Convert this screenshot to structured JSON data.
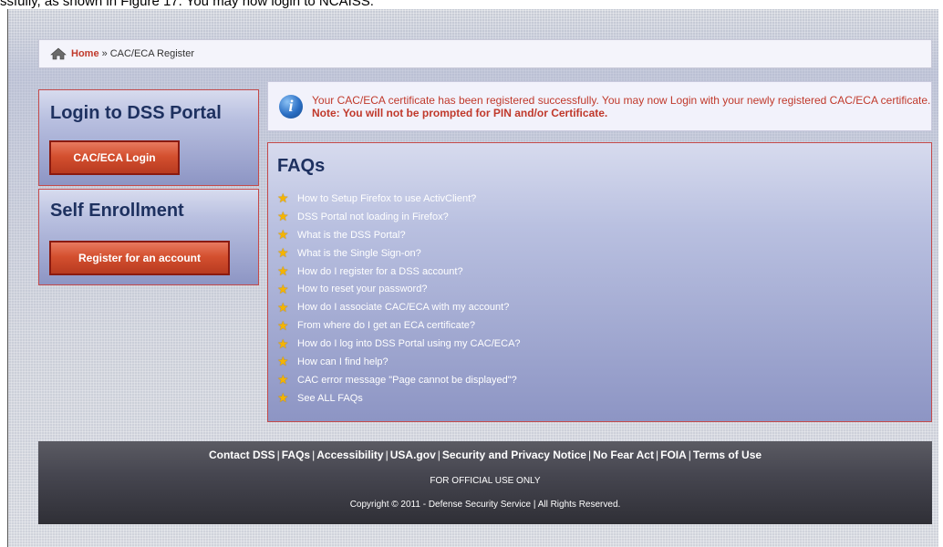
{
  "doc_caption": "ssfully, as shown in Figure 17. You may now login to NCAISS.",
  "breadcrumb": {
    "home": "Home",
    "separator": "»",
    "current": "CAC/ECA Register"
  },
  "login_panel": {
    "title": "Login to DSS Portal",
    "button": "CAC/ECA Login"
  },
  "enroll_panel": {
    "title": "Self Enrollment",
    "button": "Register for an account"
  },
  "alert": {
    "icon": "info-icon",
    "message": "Your CAC/ECA certificate has been registered successfully. You may now Login with your newly registered CAC/ECA certificate.",
    "note": "Note: You will not be prompted for PIN and/or Certificate."
  },
  "faqs": {
    "title": "FAQs",
    "items": [
      "How to Setup Firefox to use ActivClient?",
      "DSS Portal not loading in Firefox?",
      "What is the DSS Portal?",
      "What is the Single Sign-on?",
      "How do I register for a DSS account?",
      "How to reset your password?",
      "How do I associate CAC/ECA with my account?",
      "From where do I get an ECA certificate?",
      "How do I log into DSS Portal using my CAC/ECA?",
      "How can I find help?",
      "CAC error message \"Page cannot be displayed\"?",
      "See ALL FAQs"
    ]
  },
  "footer": {
    "links": [
      "Contact DSS",
      "FAQs",
      "Accessibility",
      "USA.gov",
      "Security and Privacy Notice",
      "No Fear Act",
      "FOIA",
      "Terms of Use"
    ],
    "fouo": "FOR OFFICIAL USE ONLY",
    "copyright": "Copyright © 2011 - Defense Security Service | All Rights Reserved."
  },
  "colors": {
    "accent_red": "#c0392b",
    "title_navy": "#1e3160",
    "star": "#f5b400"
  }
}
